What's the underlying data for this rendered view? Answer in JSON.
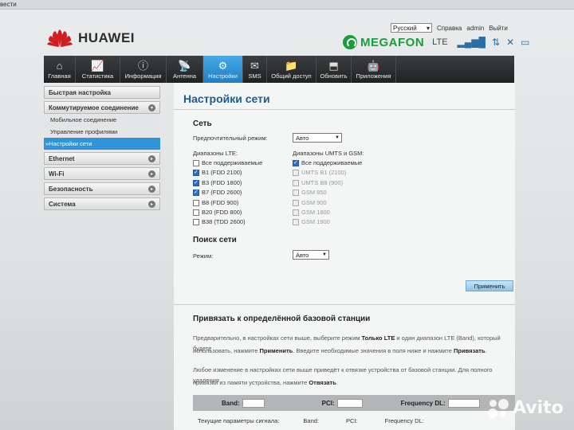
{
  "browser": {
    "partial_title": "вести"
  },
  "header": {
    "brand": "HUAWEI",
    "language": "Русский",
    "help": "Справка",
    "user": "admin",
    "logout": "Выйти",
    "operator": "MEGAFON",
    "network_type": "LTE"
  },
  "nav": [
    {
      "label": "Главная",
      "icon": "home-icon"
    },
    {
      "label": "Статистика",
      "icon": "chart-icon"
    },
    {
      "label": "Информация",
      "icon": "info-icon"
    },
    {
      "label": "Антенна",
      "icon": "antenna-icon"
    },
    {
      "label": "Настройки",
      "icon": "gear-icon",
      "active": true
    },
    {
      "label": "SMS",
      "icon": "envelope-icon"
    },
    {
      "label": "Общий доступ",
      "icon": "folder-icon"
    },
    {
      "label": "Обновить",
      "icon": "update-icon"
    },
    {
      "label": "Приложения",
      "icon": "android-icon"
    }
  ],
  "sidebar": {
    "quick": "Быстрая настройка",
    "dialup": "Коммутируемое соединение",
    "dialup_items": [
      "Мобильное соединение",
      "Управление профилями",
      "Настройки сети"
    ],
    "groups": [
      "Ethernet",
      "Wi-Fi",
      "Безопасность",
      "Система"
    ]
  },
  "main": {
    "title": "Настройки сети",
    "network_section": "Сеть",
    "pref_mode_label": "Предпочтительный режим:",
    "pref_mode_value": "Авто",
    "lte_label": "Диапазоны LTE:",
    "umts_label": "Диапазоны UMTS и GSM:",
    "lte_bands": [
      {
        "label": "Все поддерживаемые",
        "checked": false
      },
      {
        "label": "B1 (FDD 2100)",
        "checked": true
      },
      {
        "label": "B3 (FDD 1800)",
        "checked": true
      },
      {
        "label": "B7 (FDD 2600)",
        "checked": true
      },
      {
        "label": "B8 (FDD 900)",
        "checked": false
      },
      {
        "label": "B20 (FDD 800)",
        "checked": false
      },
      {
        "label": "B38 (TDD 2600)",
        "checked": false
      }
    ],
    "umts_bands": [
      {
        "label": "Все поддерживаемые",
        "checked": true,
        "disabled": false
      },
      {
        "label": "UMTS B1 (2100)",
        "checked": false,
        "disabled": true
      },
      {
        "label": "UMTS B8 (900)",
        "checked": false,
        "disabled": true
      },
      {
        "label": "GSM 850",
        "checked": false,
        "disabled": true
      },
      {
        "label": "GSM 900",
        "checked": false,
        "disabled": true
      },
      {
        "label": "GSM 1800",
        "checked": false,
        "disabled": true
      },
      {
        "label": "GSM 1900",
        "checked": false,
        "disabled": true
      }
    ],
    "search_section": "Поиск сети",
    "mode_label": "Режим:",
    "mode_value": "Авто",
    "apply": "Применить",
    "bind_title": "Привязать к определённой базовой станции",
    "para1_a": "Предварительно, в настройках сети выше, выберите режим ",
    "para1_b": "Только LTE",
    "para1_c": " и один диапазон LTE (Band), который будете",
    "para2_a": "использовать, нажмите ",
    "para2_b": "Применить",
    "para2_c": ". Введите необходимые значения в поля ниже и нажмите ",
    "para2_d": "Привязать",
    "para2_e": ".",
    "para3": "Любое изменение в настройках сети выше приведёт к отвязке устройства от базовой станции. Для полного удаления",
    "para4_a": "привязки из памяти устройства, нажмите ",
    "para4_b": "Отвязать",
    "para4_c": ".",
    "band_label": "Band:",
    "pci_label": "PCI:",
    "freq_label": "Frequency DL:",
    "signal_label": "Текущие параметры сигнала:",
    "sig_band": "Band:",
    "sig_pci": "PCI:",
    "sig_freq": "Frequency DL:"
  },
  "watermark": "Avito"
}
